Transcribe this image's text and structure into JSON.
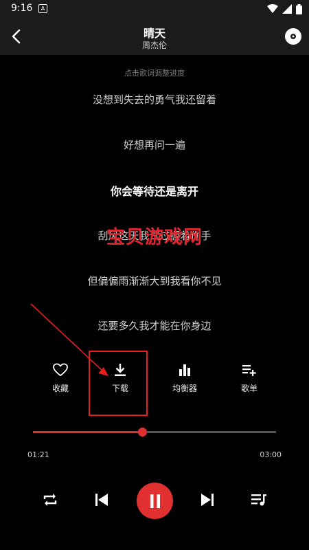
{
  "status": {
    "time": "9:16",
    "notif_icon": "A"
  },
  "header": {
    "title": "晴天",
    "artist": "周杰伦"
  },
  "lyrics": {
    "hint": "点击歌词调整进度",
    "lines": [
      "没想到失去的勇气我还留着",
      "好想再问一遍",
      "你会等待还是离开",
      "刮风这天我试过握着你手",
      "但偏偏雨渐渐大到我看你不见",
      "还要多久我才能在你身边"
    ],
    "current_index": 2
  },
  "watermark": "宝贝游戏网",
  "actions": [
    {
      "label": "收藏",
      "icon": "heart-icon"
    },
    {
      "label": "下载",
      "icon": "download-icon"
    },
    {
      "label": "均衡器",
      "icon": "equalizer-icon"
    },
    {
      "label": "歌单",
      "icon": "playlist-add-icon"
    }
  ],
  "player": {
    "current_time": "01:21",
    "total_time": "03:00",
    "progress": 0.45,
    "state": "playing"
  },
  "colors": {
    "accent": "#e0302f",
    "annotation": "#e81e1e",
    "background": "#000000",
    "header": "#1b1b1b"
  }
}
